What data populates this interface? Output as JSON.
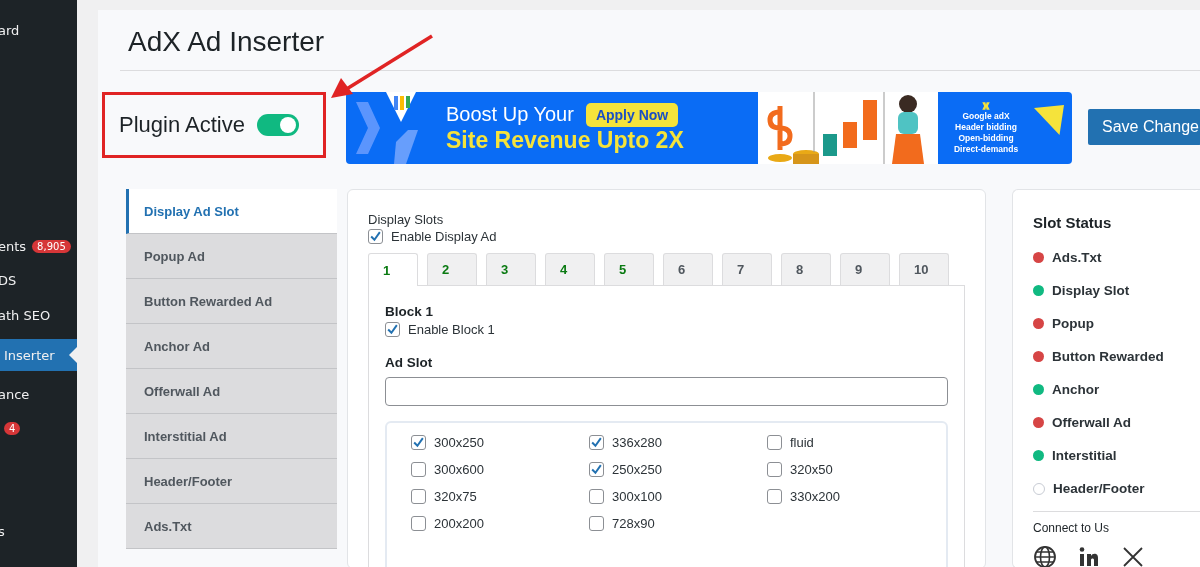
{
  "admin_menu": {
    "items": [
      {
        "label": "ard",
        "selected": false
      },
      {
        "label": "ents",
        "badge": "8,905",
        "selected": false
      },
      {
        "label": "DS",
        "selected": false
      },
      {
        "label": "ath SEO",
        "selected": false
      },
      {
        "label": "Inserter",
        "selected": true
      },
      {
        "label": "ance",
        "selected": false
      },
      {
        "badge": "4",
        "selected": false
      },
      {
        "label": "s",
        "selected": false
      }
    ]
  },
  "page": {
    "title": "AdX Ad Inserter"
  },
  "plugin_toggle": {
    "label": "Plugin Active",
    "on": true
  },
  "banner": {
    "line_1": "Boost Up Your",
    "line_2": "Site Revenue Upto 2X",
    "cta": "Apply Now",
    "features": [
      "Google adX",
      "Header bidding",
      "Open-bidding",
      "Direct-demands"
    ]
  },
  "save_button": "Save Change",
  "nav": [
    {
      "label": "Display Ad Slot",
      "selected": true
    },
    {
      "label": "Popup Ad",
      "selected": false
    },
    {
      "label": "Button Rewarded Ad",
      "selected": false
    },
    {
      "label": "Anchor Ad",
      "selected": false
    },
    {
      "label": "Offerwall Ad",
      "selected": false
    },
    {
      "label": "Interstitial Ad",
      "selected": false
    },
    {
      "label": "Header/Footer",
      "selected": false
    },
    {
      "label": "Ads.Txt",
      "selected": false
    }
  ],
  "display_slots": {
    "heading": "Display Slots",
    "enable": {
      "label": "Enable Display Ad",
      "checked": true
    },
    "tabs": [
      {
        "label": "1",
        "selected": true,
        "enabled": true
      },
      {
        "label": "2",
        "selected": false,
        "enabled": true
      },
      {
        "label": "3",
        "selected": false,
        "enabled": true
      },
      {
        "label": "4",
        "selected": false,
        "enabled": true
      },
      {
        "label": "5",
        "selected": false,
        "enabled": true
      },
      {
        "label": "6",
        "selected": false,
        "enabled": false
      },
      {
        "label": "7",
        "selected": false,
        "enabled": false
      },
      {
        "label": "8",
        "selected": false,
        "enabled": false
      },
      {
        "label": "9",
        "selected": false,
        "enabled": false
      },
      {
        "label": "10",
        "selected": false,
        "enabled": false
      }
    ],
    "block": {
      "title": "Block 1",
      "enable": {
        "label": "Enable Block 1",
        "checked": true
      },
      "ad_slot_label": "Ad Slot",
      "sizes": [
        {
          "label": "300x250",
          "checked": true
        },
        {
          "label": "336x280",
          "checked": true
        },
        {
          "label": "fluid",
          "checked": false
        },
        {
          "label": "300x600",
          "checked": false
        },
        {
          "label": "250x250",
          "checked": true
        },
        {
          "label": "320x50",
          "checked": false
        },
        {
          "label": "320x75",
          "checked": false
        },
        {
          "label": "300x100",
          "checked": false
        },
        {
          "label": "330x200",
          "checked": false
        },
        {
          "label": "200x200",
          "checked": false
        },
        {
          "label": "728x90",
          "checked": false
        }
      ]
    }
  },
  "slot_status": {
    "title": "Slot Status",
    "items": [
      {
        "label": "Ads.Txt",
        "color": "#d64545",
        "hollow": false
      },
      {
        "label": "Display Slot",
        "color": "#10b981",
        "hollow": false
      },
      {
        "label": "Popup",
        "color": "#d64545",
        "hollow": false
      },
      {
        "label": "Button Rewarded",
        "color": "#d64545",
        "hollow": false
      },
      {
        "label": "Anchor",
        "color": "#10b981",
        "hollow": false
      },
      {
        "label": "Offerwall Ad",
        "color": "#d64545",
        "hollow": false
      },
      {
        "label": "Interstitial",
        "color": "#10b981",
        "hollow": false
      },
      {
        "label": "Header/Footer",
        "color": "#c8ccd4",
        "hollow": true
      }
    ],
    "connect": "Connect to Us"
  }
}
